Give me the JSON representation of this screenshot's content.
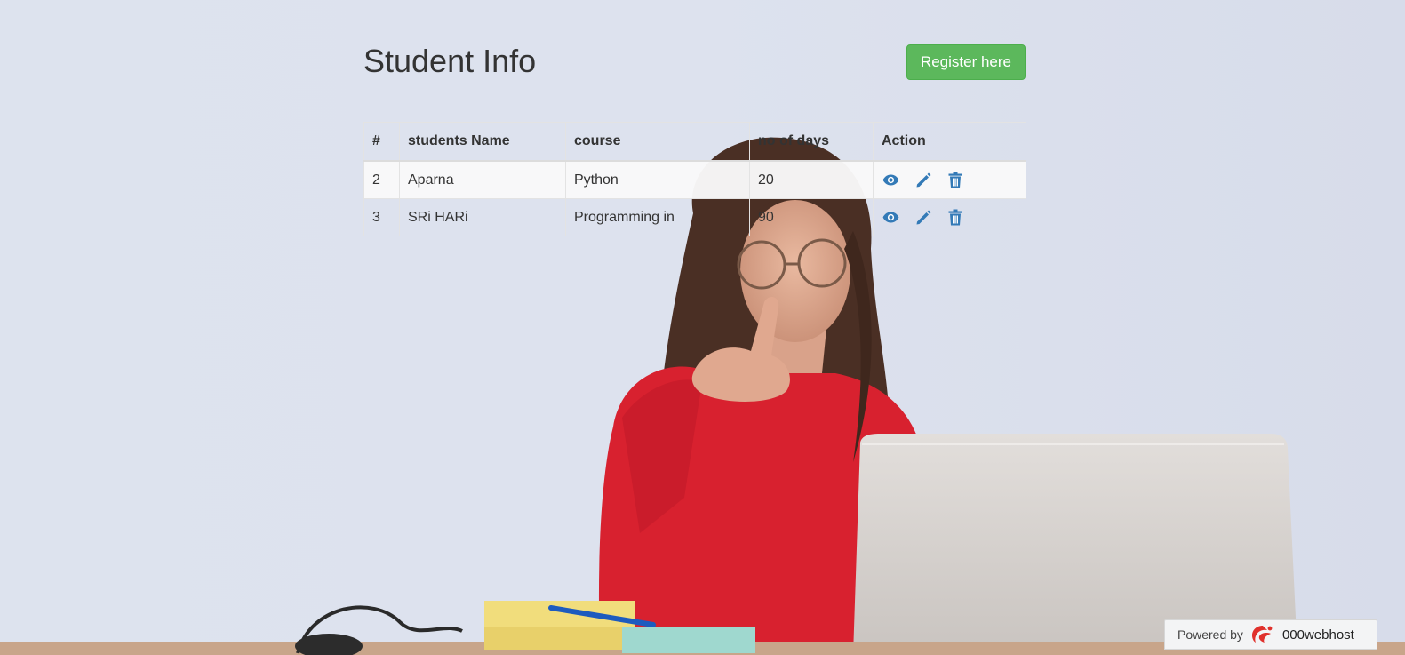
{
  "page": {
    "title": "Student Info",
    "register_label": "Register here"
  },
  "table": {
    "columns": [
      "#",
      "students Name",
      "course",
      "no of days",
      "Action"
    ],
    "rows": [
      {
        "id": "2",
        "name": "Aparna",
        "course": "Python",
        "days": "20"
      },
      {
        "id": "3",
        "name": "SRi HARi",
        "course": "Programming in",
        "days": "90"
      }
    ],
    "action_icons": [
      "eye-icon",
      "pencil-icon",
      "trash-icon"
    ]
  },
  "footer": {
    "powered_label": "Powered by",
    "brand": "000webhost"
  },
  "colors": {
    "register_button": "#5cb85c",
    "action_icon": "#337ab7",
    "background": "#dfe4ee"
  }
}
